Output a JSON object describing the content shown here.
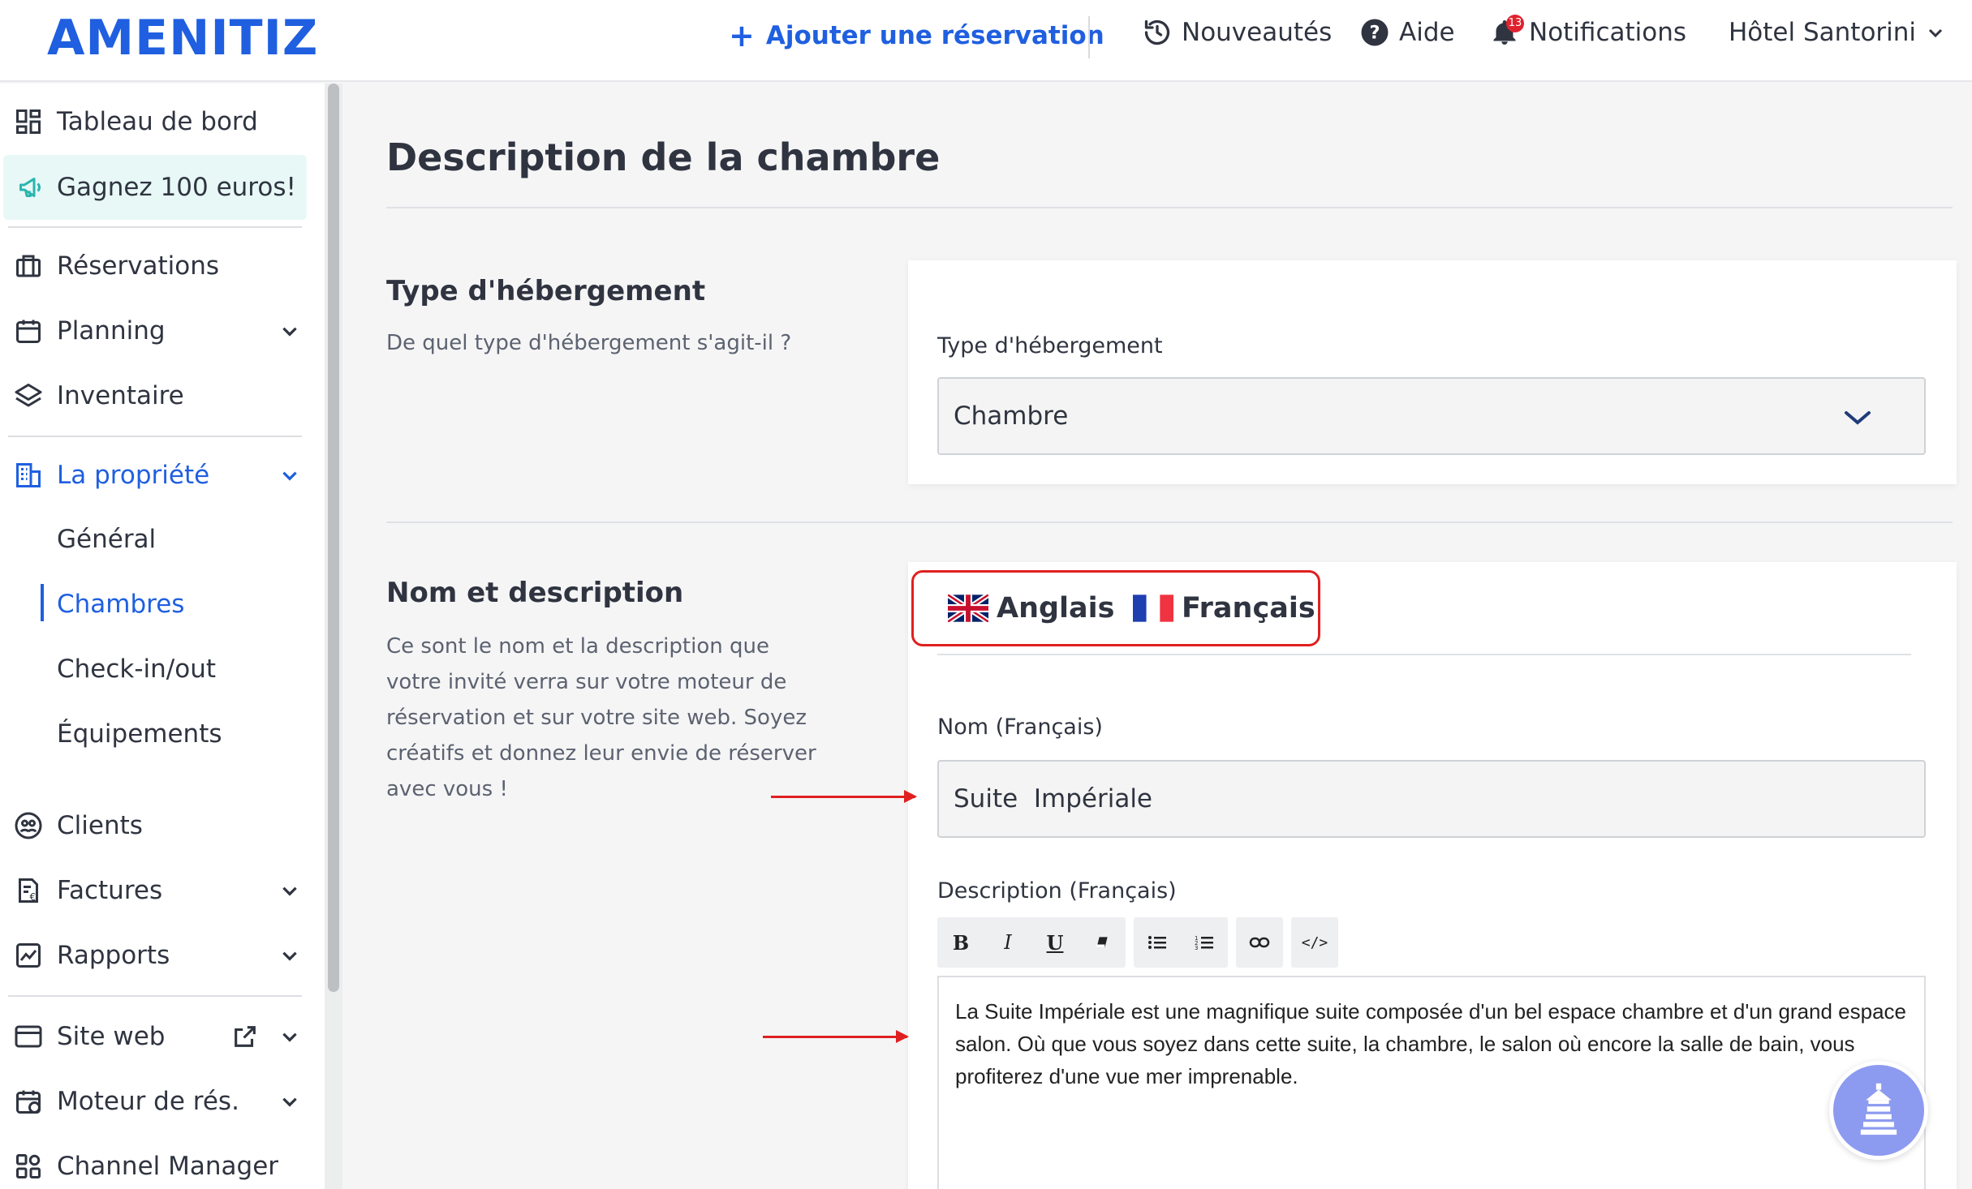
{
  "header": {
    "logo": "AMENITIZ",
    "add_reservation": "Ajouter une réservation",
    "news": "Nouveautés",
    "help": "Aide",
    "notifications": "Notifications",
    "notification_count": "13",
    "hotel": "Hôtel Santorini"
  },
  "sidebar": {
    "dashboard": "Tableau de bord",
    "promo": "Gagnez 100 euros!",
    "reservations": "Réservations",
    "planning": "Planning",
    "inventory": "Inventaire",
    "property": "La propriété",
    "sub": {
      "general": "Général",
      "rooms": "Chambres",
      "checkin": "Check-in/out",
      "equipment": "Équipements"
    },
    "clients": "Clients",
    "invoices": "Factures",
    "reports": "Rapports",
    "website": "Site web",
    "booking_engine": "Moteur de rés.",
    "channel_manager": "Channel Manager"
  },
  "main": {
    "title": "Description de la chambre",
    "type_section": {
      "title": "Type d'hébergement",
      "desc": "De quel type d'hébergement s'agit-il ?",
      "field_label": "Type d'hébergement",
      "value": "Chambre"
    },
    "name_section": {
      "title": "Nom et description",
      "desc": "Ce sont le nom et la description que votre invité verra sur votre moteur de réservation et sur votre site web. Soyez créatifs et donnez leur envie de réserver avec vous !",
      "tab_en": "Anglais",
      "tab_fr": "Français",
      "name_label": "Nom (Français)",
      "name_value": "Suite  Impériale",
      "desc_label": "Description (Français)",
      "desc_value": "La Suite Impériale est une magnifique suite composée d'un bel espace chambre et d'un grand espace salon. Où que vous soyez dans cette suite, la chambre, le salon où encore la salle de bain, vous profiterez d'une vue mer imprenable.",
      "toolbar": {
        "bold": "B",
        "italic": "I",
        "underline": "U",
        "code": "</>"
      }
    }
  },
  "colors": {
    "brand": "#1f5fe0",
    "annotation": "#e02020",
    "promo_bg": "#e8f8f7"
  }
}
